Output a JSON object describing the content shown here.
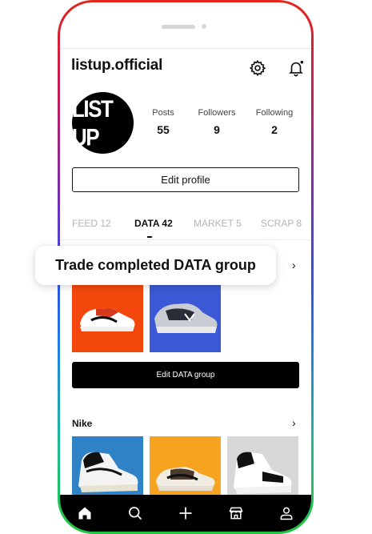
{
  "header": {
    "username": "listup.official"
  },
  "profile": {
    "avatar_text": "LIST UP",
    "stats": [
      {
        "label": "Posts",
        "value": "55"
      },
      {
        "label": "Followers",
        "value": "9"
      },
      {
        "label": "Following",
        "value": "2"
      }
    ],
    "edit_profile_label": "Edit profile"
  },
  "tabs": [
    {
      "label": "FEED 12",
      "active": false
    },
    {
      "label": "DATA 42",
      "active": true
    },
    {
      "label": "MARKET 5",
      "active": false
    },
    {
      "label": "SCRAP 8",
      "active": false
    }
  ],
  "data_group": {
    "tooltip": "Trade completed DATA group",
    "edit_label": "Edit DATA group"
  },
  "nike_section": {
    "title": "Nike"
  },
  "icons": {
    "settings": "gear-icon",
    "notifications": "bell-icon",
    "home": "home-icon",
    "search": "search-icon",
    "add": "plus-icon",
    "market": "store-icon",
    "profile": "user-icon"
  },
  "colors": {
    "tile_orange_red": "#f4470c",
    "tile_blue": "#3b59d6",
    "tile_sky": "#2f82c6",
    "tile_amber": "#f6a31f",
    "tile_gray": "#d7d7d7"
  }
}
